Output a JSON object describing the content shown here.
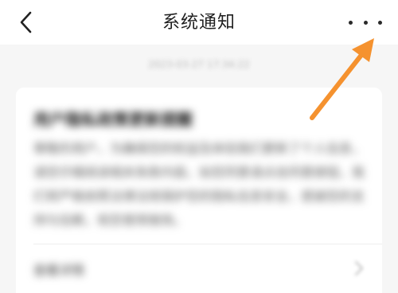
{
  "header": {
    "title": "系统通知"
  },
  "notification": {
    "timestamp": "2023-03-27 17:34:22",
    "title": "用户隐私政策更新提醒",
    "body": "尊敬的用户，为确保您的权益及体验我们更新了个人信息，请您仔细阅读相关条款内容。如您同意请点击同意按钮，我们将严格依照法律法规保护您的隐私信息安全，感谢您的支持与信赖，祝您使用愉快。",
    "detail_label": "查看详情"
  },
  "colors": {
    "annotation_arrow": "#f5922f"
  }
}
